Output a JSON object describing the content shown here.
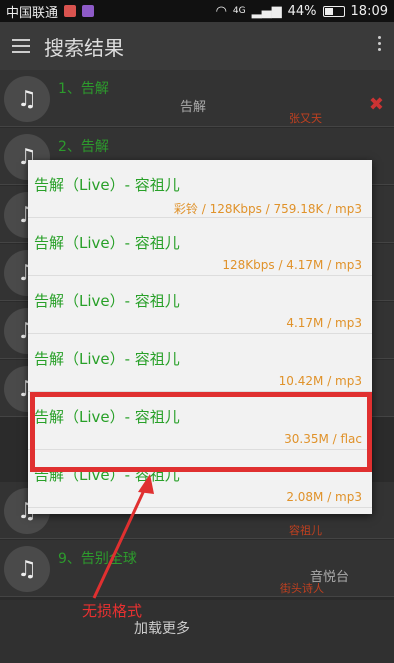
{
  "status": {
    "carrier": "中国联通",
    "network": "4G",
    "battery": "44%",
    "time": "18:09"
  },
  "appbar": {
    "title": "搜索结果"
  },
  "list": [
    {
      "title": "1、告解",
      "sub": "告解",
      "singer": "张又天"
    },
    {
      "title": "2、告解",
      "sub": "",
      "singer": ""
    },
    {
      "title": "",
      "sub": "",
      "singer": ""
    },
    {
      "title": "",
      "sub": "",
      "singer": ""
    },
    {
      "title": "",
      "sub": "",
      "singer": ""
    },
    {
      "title": "",
      "sub": "",
      "singer": ""
    },
    {
      "title": "",
      "sub": "",
      "singer": "容祖儿"
    },
    {
      "title": "9、告别全球",
      "sub": "音悦台",
      "singer": "街头诗人"
    }
  ],
  "load_more": "加载更多",
  "dialog": {
    "options": [
      {
        "title": "告解（Live）- 容祖儿",
        "meta": "彩铃 / 128Kbps / 759.18K / mp3"
      },
      {
        "title": "告解（Live）- 容祖儿",
        "meta": "128Kbps / 4.17M / mp3"
      },
      {
        "title": "告解（Live）- 容祖儿",
        "meta": "4.17M / mp3"
      },
      {
        "title": "告解（Live）- 容祖儿",
        "meta": "10.42M / mp3"
      },
      {
        "title": "告解（Live）- 容祖儿",
        "meta": "30.35M / flac"
      },
      {
        "title": "告解（Live）- 容祖儿",
        "meta": "2.08M / mp3"
      }
    ]
  },
  "annotation": "无损格式",
  "colors": {
    "accent_green": "#28a028",
    "meta_orange": "#e0922a",
    "highlight_red": "#e03030"
  },
  "icons": {
    "music": "music-note-icon"
  }
}
